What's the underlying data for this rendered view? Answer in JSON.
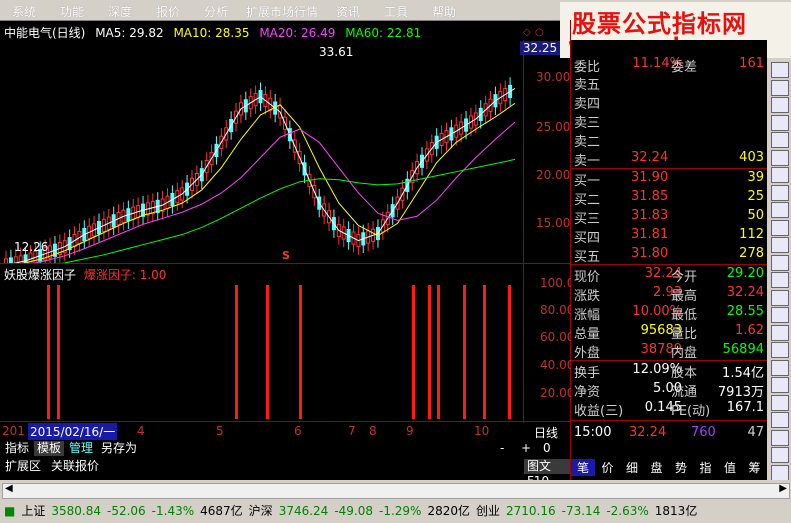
{
  "menu": [
    "系统",
    "功能",
    "深度",
    "报价",
    "分析",
    "扩展市场行情",
    "资讯",
    "工具",
    "帮助"
  ],
  "brand": {
    "line1": "股票公式指标网",
    "line2": "www.gszb.com"
  },
  "chart": {
    "title": "中能电气(日线)",
    "ma5": "MA5: 29.82",
    "ma10": "MA10: 28.35",
    "ma20": "MA20: 26.49",
    "ma60": "MA60: 22.81",
    "price_tag": "32.25",
    "high_label": "33.61",
    "low_label": "12.26",
    "y_ticks": [
      "30.00",
      "25.00",
      "20.00",
      "15.00"
    ],
    "x_ticks": [
      "201",
      "4",
      "5",
      "6",
      "7",
      "8",
      "9",
      "10",
      "11"
    ],
    "date_label": "2015/02/16/一",
    "s_marker": "S",
    "colors": {
      "ma5": "#ffffff",
      "ma10": "#ffff00",
      "ma20": "#ff40ff",
      "ma60": "#00ff00",
      "up": "#ff3232",
      "down": "#54ffff"
    }
  },
  "chart_data": [
    {
      "type": "line",
      "title": "中能电气(日线)",
      "series": [
        {
          "name": "MA5",
          "values": [
            12.4,
            12.8,
            13.5,
            14.2,
            15.4,
            16.3,
            17.2,
            17.8,
            18.3,
            19.4,
            21.3,
            24.5,
            27.8,
            29.0,
            27.5,
            23.0,
            18.5,
            15.8,
            14.8,
            15.5,
            18.5,
            22.0,
            24.5,
            25.6,
            26.8,
            28.6,
            29.82
          ]
        },
        {
          "name": "MA10",
          "values": [
            12.3,
            12.6,
            13.1,
            13.8,
            14.7,
            15.6,
            16.5,
            17.3,
            17.8,
            18.5,
            19.8,
            22.0,
            24.8,
            27.2,
            28.2,
            26.0,
            22.0,
            18.5,
            16.3,
            15.3,
            16.5,
            19.5,
            22.5,
            24.5,
            25.8,
            27.0,
            28.35
          ]
        },
        {
          "name": "MA20",
          "values": [
            12.2,
            12.4,
            12.8,
            13.3,
            14.0,
            14.8,
            15.6,
            16.4,
            17.0,
            17.6,
            18.4,
            19.5,
            21.0,
            23.0,
            25.0,
            25.8,
            24.5,
            22.0,
            19.5,
            17.5,
            16.8,
            17.2,
            18.8,
            21.0,
            23.0,
            24.8,
            26.49
          ]
        },
        {
          "name": "MA60",
          "values": [
            12.0,
            12.1,
            12.3,
            12.6,
            13.0,
            13.4,
            13.9,
            14.4,
            14.9,
            15.4,
            16.1,
            17.0,
            18.0,
            19.0,
            19.9,
            20.6,
            20.9,
            20.8,
            20.5,
            20.3,
            20.4,
            20.8,
            21.2,
            21.6,
            22.0,
            22.4,
            22.81
          ]
        }
      ],
      "ylim": [
        12,
        34
      ]
    },
    {
      "type": "bar",
      "title": "妖股爆涨因子",
      "legend": "爆涨因子: 1.00",
      "y_ticks": [
        "100.0",
        "80.00",
        "60.00",
        "40.00",
        "20.00"
      ],
      "values": [
        100,
        100,
        100,
        100,
        100,
        100,
        100,
        100,
        100,
        100,
        100,
        100
      ],
      "ylim": [
        0,
        100
      ]
    }
  ],
  "sub": {
    "name": "妖股爆涨因子",
    "legend": "爆涨因子: 1.00"
  },
  "quote": {
    "top": {
      "label": "委比",
      "v": "11.14%",
      "label2": "委差",
      "v2": "161"
    },
    "sells": [
      {
        "l": "卖五",
        "p": "",
        "q": ""
      },
      {
        "l": "卖四",
        "p": "",
        "q": ""
      },
      {
        "l": "卖三",
        "p": "",
        "q": ""
      },
      {
        "l": "卖二",
        "p": "",
        "q": ""
      },
      {
        "l": "卖一",
        "p": "32.24",
        "q": "403"
      }
    ],
    "buys": [
      {
        "l": "买一",
        "p": "31.90",
        "q": "39"
      },
      {
        "l": "买二",
        "p": "31.85",
        "q": "25"
      },
      {
        "l": "买三",
        "p": "31.83",
        "q": "50"
      },
      {
        "l": "买四",
        "p": "31.81",
        "q": "112"
      },
      {
        "l": "买五",
        "p": "31.80",
        "q": "278"
      }
    ],
    "stats": [
      {
        "l": "现价",
        "v": "32.24",
        "l2": "今开",
        "v2": "29.20"
      },
      {
        "l": "涨跌",
        "v": "2.93",
        "l2": "最高",
        "v2": "32.24"
      },
      {
        "l": "涨幅",
        "v": "10.00%",
        "l2": "最低",
        "v2": "28.55"
      },
      {
        "l": "总量",
        "v": "95683",
        "l2": "量比",
        "v2": "1.62"
      },
      {
        "l": "外盘",
        "v": "38789",
        "l2": "内盘",
        "v2": "56894"
      }
    ],
    "stats2": [
      {
        "l": "换手",
        "v": "12.09%",
        "l2": "股本",
        "v2": "1.54亿"
      },
      {
        "l": "净资",
        "v": "5.00",
        "l2": "流通",
        "v2": "7913万"
      },
      {
        "l": "收益(三)",
        "v": "0.145",
        "l2": "PE(动)",
        "v2": "167.1"
      }
    ],
    "tick": {
      "time": "15:00",
      "price": "32.24",
      "vol": "760",
      "n": "47"
    }
  },
  "bottom_tabs": [
    "指标",
    "模板",
    "管理",
    "另存为"
  ],
  "bottom_tabs2": [
    "扩展区",
    "关联报价"
  ],
  "period": "日线",
  "graph_f10": "图文F10",
  "nav_buttons": [
    "-",
    "+",
    "0"
  ],
  "right_tabs": [
    "笔",
    "价",
    "细",
    "盘",
    "势",
    "指",
    "值",
    "筹"
  ],
  "ticker": [
    {
      "name": "上证",
      "price": "3580.84",
      "chg": "-52.06",
      "pct": "-1.43%",
      "amt": "4687亿"
    },
    {
      "name": "沪深",
      "price": "3746.24",
      "chg": "-49.08",
      "pct": "-1.29%",
      "amt": "2820亿"
    },
    {
      "name": "创业",
      "price": "2710.16",
      "chg": "-73.14",
      "pct": "-2.63%",
      "amt": "1813亿"
    }
  ]
}
